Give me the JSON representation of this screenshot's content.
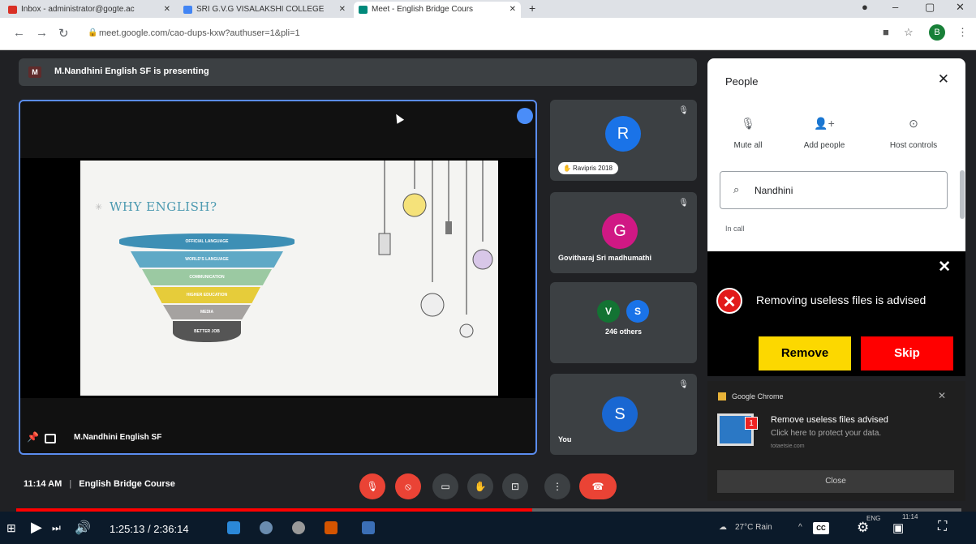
{
  "browser": {
    "tabs": [
      {
        "label": "Inbox - administrator@gogte.ac",
        "color": "#d93025"
      },
      {
        "label": "SRI G.V.G VISALAKSHI COLLEGE",
        "color": "#4285f4"
      },
      {
        "label": "Meet - English Bridge Cours",
        "color": "#00897b"
      }
    ],
    "url": "meet.google.com/cao-dups-kxw?authuser=1&pli=1",
    "profile_initial": "B"
  },
  "meet": {
    "banner_initial": "M",
    "banner_text": "M.Nandhini English SF is presenting",
    "presenter_name": "M.Nandhini English SF",
    "slide": {
      "title": "WHY ENGLISH?",
      "funnel": [
        "OFFICIAL LANGUAGE",
        "WORLD'S LANGUAGE",
        "COMMUNICATION",
        "HIGHER EDUCATION",
        "MEDIA",
        "BETTER JOB"
      ]
    },
    "participants": [
      {
        "initial": "R",
        "color": "#1a73e8",
        "name": "Ravipris 2018"
      },
      {
        "initial": "G",
        "color": "#d01884",
        "name": "Govitharaj Sri madhumathi"
      },
      {
        "initials": [
          "V",
          "S"
        ],
        "colors": [
          "#137333",
          "#1a73e8"
        ],
        "name": "246 others"
      },
      {
        "initial": "S",
        "color": "#1967d2",
        "name": "You"
      }
    ],
    "time": "11:14 AM",
    "meeting_name": "English Bridge Course"
  },
  "people_panel": {
    "title": "People",
    "actions": [
      "Mute all",
      "Add people",
      "Host controls"
    ],
    "search_value": "Nandhini",
    "section": "In call"
  },
  "popup": {
    "message": "Removing useless files is advised",
    "remove_label": "Remove",
    "skip_label": "Skip"
  },
  "notification": {
    "source": "Google Chrome",
    "title": "Remove useless files advised",
    "body": "Click here to protect your data.",
    "site": "totaetsie.com",
    "badge": "1",
    "close_label": "Close"
  },
  "player": {
    "time_display": "1:25:13 / 2:36:14",
    "progress": 0.546,
    "weather": "27°C Rain",
    "lang": "ENG",
    "clock": "11:14",
    "cc_label": "CC"
  }
}
